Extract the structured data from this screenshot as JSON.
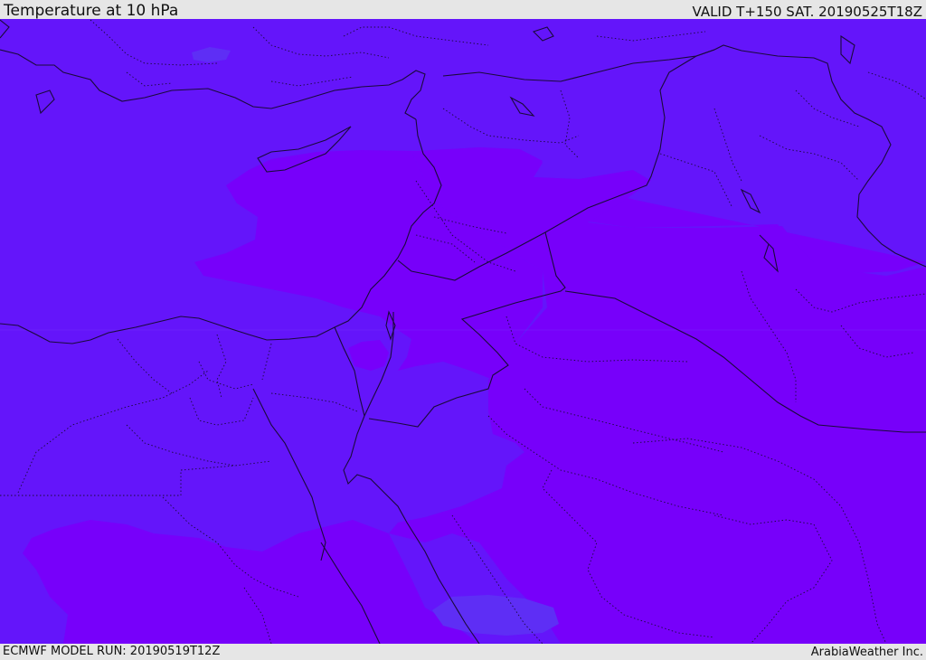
{
  "header": {
    "title": "Temperature at 10 hPa",
    "valid": "VALID T+150 SAT. 20190525T18Z"
  },
  "footer": {
    "model_run": "ECMWF MODEL RUN: 20190519T12Z",
    "credit": "ArabiaWeather Inc."
  },
  "map": {
    "colors": {
      "field_cool": "#6415fa",
      "field_warm": "#7700fa",
      "field_cool_patch": "#5e2ef5",
      "border_line": "#1a0a3a"
    },
    "legend": []
  }
}
